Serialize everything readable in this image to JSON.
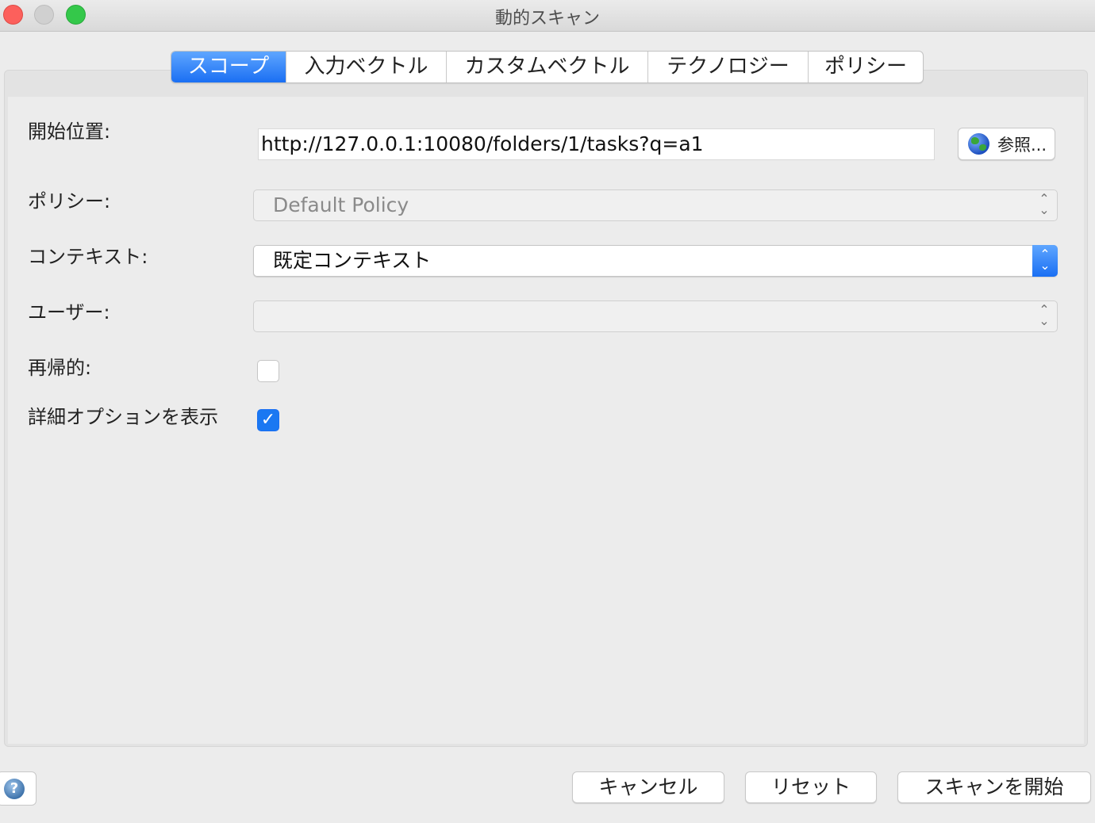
{
  "window": {
    "title": "動的スキャン"
  },
  "tabs": [
    {
      "label": "スコープ",
      "active": true
    },
    {
      "label": "入力ベクトル",
      "active": false
    },
    {
      "label": "カスタムベクトル",
      "active": false
    },
    {
      "label": "テクノロジー",
      "active": false
    },
    {
      "label": "ポリシー",
      "active": false
    }
  ],
  "form": {
    "start_label": "開始位置:",
    "start_value": "http://127.0.0.1:10080/folders/1/tasks?q=a1",
    "browse_label": "参照...",
    "policy_label": "ポリシー:",
    "policy_value": "Default Policy",
    "context_label": "コンテキスト:",
    "context_value": "既定コンテキスト",
    "user_label": "ユーザー:",
    "user_value": "",
    "recursive_label": "再帰的:",
    "recursive_checked": false,
    "advanced_label": "詳細オプションを表示",
    "advanced_checked": true
  },
  "buttons": {
    "cancel": "キャンセル",
    "reset": "リセット",
    "start": "スキャンを開始"
  },
  "icons": {
    "help": "?",
    "checkmark": "✓",
    "chevron": "⌃⌄"
  },
  "colors": {
    "accent": "#1a6ff3",
    "close": "#fc605c",
    "maximize": "#34c84a"
  }
}
